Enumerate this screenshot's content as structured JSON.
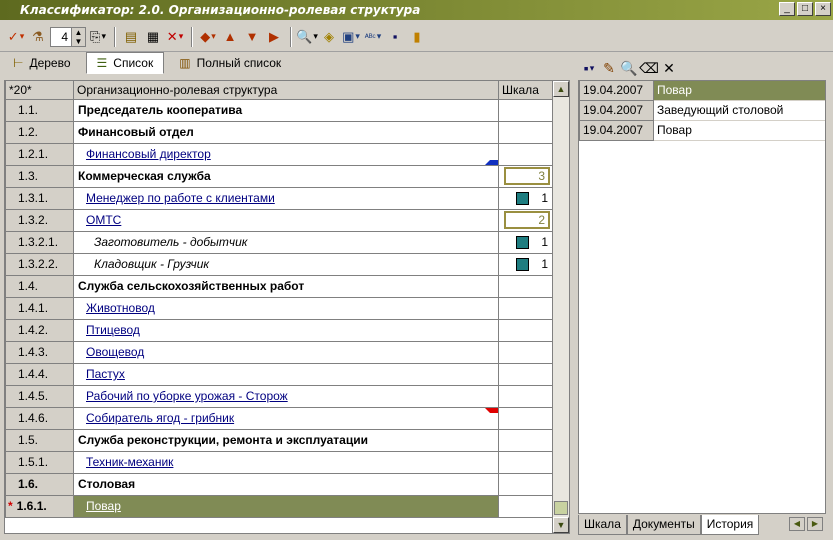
{
  "window": {
    "title": "Классификатор: 2.0. Организационно-ролевая структура",
    "controls": [
      "_",
      "□",
      "×"
    ]
  },
  "toolbar": {
    "level_value": "4",
    "icons": [
      "check-icon",
      "filter-icon",
      "copy-icon",
      "folder-icon",
      "grid-icon",
      "delete-icon",
      "arrow-left-icon",
      "arrow-up-icon",
      "arrow-down-icon",
      "arrow-right-icon",
      "preview-icon",
      "info-icon",
      "export-icon",
      "spell-icon",
      "save-icon",
      "exit-icon"
    ]
  },
  "tabs": [
    {
      "label": "Дерево",
      "icon": "tree-icon",
      "active": false
    },
    {
      "label": "Список",
      "icon": "list-icon",
      "active": true
    },
    {
      "label": "Полный список",
      "icon": "full-list-icon",
      "active": false
    }
  ],
  "grid": {
    "headers": {
      "code": "*20*",
      "name": "Организационно-ролевая структура",
      "scale": "Шкала"
    },
    "rows": [
      {
        "code": "1.1.",
        "name": "Председатель кооператива",
        "style": "bold",
        "scale": ""
      },
      {
        "code": "1.2.",
        "name": "Финансовый отдел",
        "style": "bold",
        "scale": ""
      },
      {
        "code": "1.2.1.",
        "name": "Финансовый директор",
        "style": "l2",
        "scale": "",
        "marker": "blue"
      },
      {
        "code": "1.3.",
        "name": "Коммерческая служба",
        "style": "bold",
        "scale": "3",
        "scale_type": "box"
      },
      {
        "code": "1.3.1.",
        "name": "Менеджер по работе с клиентами",
        "style": "l2",
        "scale": "1",
        "scale_type": "square"
      },
      {
        "code": "1.3.2.",
        "name": "ОМТС",
        "style": "l2",
        "scale": "2",
        "scale_type": "box"
      },
      {
        "code": "1.3.2.1.",
        "name": "Заготовитель - добытчик",
        "style": "l3",
        "scale": "1",
        "scale_type": "square"
      },
      {
        "code": "1.3.2.2.",
        "name": "Кладовщик - Грузчик",
        "style": "l3",
        "scale": "1",
        "scale_type": "square"
      },
      {
        "code": "1.4.",
        "name": "Служба сельскохозяйственных работ",
        "style": "bold",
        "scale": ""
      },
      {
        "code": "1.4.1.",
        "name": "Животновод",
        "style": "l2",
        "scale": ""
      },
      {
        "code": "1.4.2.",
        "name": "Птицевод",
        "style": "l2",
        "scale": ""
      },
      {
        "code": "1.4.3.",
        "name": "Овощевод",
        "style": "l2",
        "scale": ""
      },
      {
        "code": "1.4.4.",
        "name": "Пастух",
        "style": "l2",
        "scale": ""
      },
      {
        "code": "1.4.5.",
        "name": "Рабочий по уборке урожая - Сторож",
        "style": "l2",
        "scale": ""
      },
      {
        "code": "1.4.6.",
        "name": "Собиратель ягод - грибник",
        "style": "l2",
        "scale": "",
        "marker": "red"
      },
      {
        "code": "1.5.",
        "name": "Служба реконструкции, ремонта и эксплуатации",
        "style": "bold",
        "scale": ""
      },
      {
        "code": "1.5.1.",
        "name": "Техник-механик",
        "style": "l2",
        "scale": ""
      },
      {
        "code": "1.6.",
        "name": "Столовая",
        "style": "bold",
        "scale": "",
        "code_bold": true
      },
      {
        "code": "1.6.1.",
        "name": "Повар",
        "style": "l2",
        "scale": "",
        "selected": true,
        "code_bold": true,
        "current_mark": "*"
      }
    ]
  },
  "history": {
    "icons": [
      "save-icon",
      "edit-icon",
      "preview-icon",
      "eraser-icon",
      "close-icon"
    ],
    "rows": [
      {
        "date": "19.04.2007",
        "text": "Повар",
        "selected": true
      },
      {
        "date": "19.04.2007",
        "text": "Заведующий столовой"
      },
      {
        "date": "19.04.2007",
        "text": "Повар"
      }
    ],
    "tabs": [
      {
        "label": "Шкала",
        "active": false
      },
      {
        "label": "Документы",
        "active": false
      },
      {
        "label": "История",
        "active": true
      }
    ]
  }
}
